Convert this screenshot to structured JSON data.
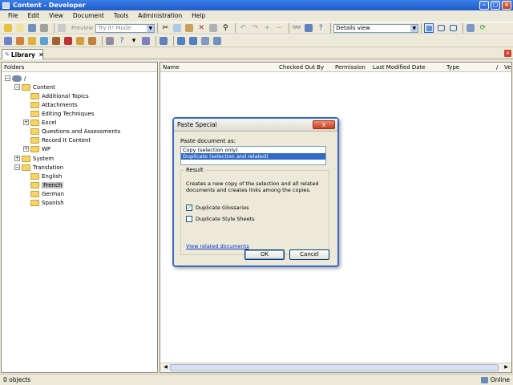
{
  "window": {
    "title": "Content - Developer"
  },
  "menu": [
    "File",
    "Edit",
    "View",
    "Document",
    "Tools",
    "Administration",
    "Help"
  ],
  "toolbar": {
    "preview_label": "Preview",
    "mode_select": "Try It! Mode",
    "view_select": "Details view"
  },
  "tab": {
    "label": "Library"
  },
  "folders": {
    "header": "Folders",
    "root": "/",
    "content": "Content",
    "content_items": [
      "Additional Topics",
      "Attachments",
      "Editing Techniques",
      "Excel",
      "Questions and Assessments",
      "Record It Content",
      "WP"
    ],
    "system": "System",
    "translation": "Translation",
    "translation_items": [
      "English",
      "French",
      "German",
      "Spanish"
    ],
    "selected": "French"
  },
  "details": {
    "columns": [
      "Name",
      "Checked Out By",
      "Permission",
      "Last Modified Date",
      "Type",
      "/",
      "Ve"
    ]
  },
  "status": {
    "objects": "0 objects",
    "connection": "Online"
  },
  "dialog": {
    "title": "Paste Special",
    "close_label": "X",
    "paste_as_label": "Paste document as:",
    "options": [
      "Copy (selection only)",
      "Duplicate (selection and related)"
    ],
    "selected_option": 1,
    "result_label": "Result",
    "result_desc": "Creates a new copy of the selection and all related documents and creates links among the copies.",
    "dup_glossaries": "Duplicate Glossaries",
    "dup_glossaries_checked": true,
    "dup_stylesheets": "Duplicate Style Sheets",
    "dup_stylesheets_checked": false,
    "related_link": "View related documents",
    "ok": "OK",
    "cancel": "Cancel"
  }
}
